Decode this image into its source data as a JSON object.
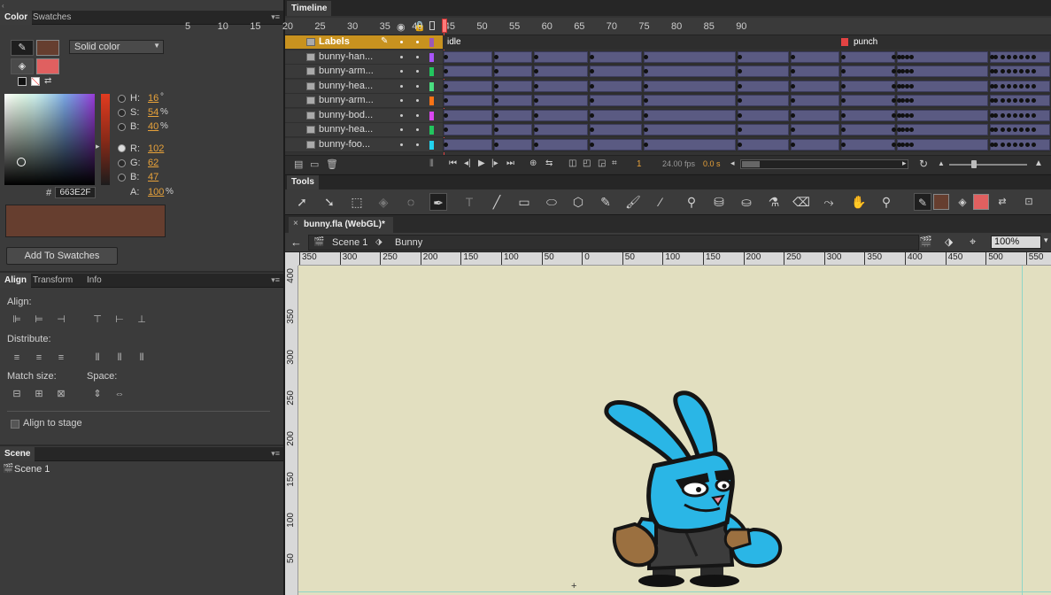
{
  "color_panel": {
    "tabs": [
      "Color",
      "Swatches"
    ],
    "fill_type": "Solid color",
    "hsb": {
      "h_label": "H:",
      "h": "16",
      "h_unit": "°",
      "s_label": "S:",
      "s": "54",
      "s_unit": "%",
      "b_label": "B:",
      "b": "40",
      "b_unit": "%"
    },
    "rgb": {
      "r_label": "R:",
      "r": "102",
      "g_label": "G:",
      "g": "62",
      "b_label": "B:",
      "b": "47"
    },
    "hex_prefix": "#",
    "hex": "663E2F",
    "alpha_label": "A:",
    "alpha": "100",
    "alpha_unit": "%",
    "add_swatch_label": "Add To Swatches",
    "colors": {
      "stroke": "#663e2f",
      "fill": "#e06060"
    }
  },
  "align_panel": {
    "tabs": [
      "Align",
      "Transform",
      "Info"
    ],
    "align_label": "Align:",
    "distribute_label": "Distribute:",
    "match_size_label": "Match size:",
    "space_label": "Space:",
    "align_to_stage": "Align to stage"
  },
  "scene_panel": {
    "tab": "Scene",
    "items": [
      "Scene 1"
    ]
  },
  "timeline": {
    "title": "Timeline",
    "frame_numbers": [
      "5",
      "10",
      "15",
      "20",
      "25",
      "30",
      "35",
      "40",
      "45",
      "50",
      "55",
      "60",
      "65",
      "70",
      "75",
      "80",
      "85",
      "90"
    ],
    "layers": [
      {
        "name": "Labels",
        "color": "#9b59b6"
      },
      {
        "name": "bunny-han...",
        "color": "#a855f7"
      },
      {
        "name": "bunny-arm...",
        "color": "#22c55e"
      },
      {
        "name": "bunny-hea...",
        "color": "#4ade80"
      },
      {
        "name": "bunny-arm...",
        "color": "#f97316"
      },
      {
        "name": "bunny-bod...",
        "color": "#d946ef"
      },
      {
        "name": "bunny-hea...",
        "color": "#22c55e"
      },
      {
        "name": "bunny-foo...",
        "color": "#22d3ee"
      }
    ],
    "labels": [
      "idle",
      "punch"
    ],
    "current_frame": "1",
    "fps": "24.00 fps",
    "time": "0.0 s"
  },
  "tools_panel": {
    "title": "Tools",
    "stroke_color": "#663e2f",
    "fill_color": "#e06060"
  },
  "document": {
    "tab": "bunny.fla (WebGL)*",
    "breadcrumb_scene": "Scene 1",
    "breadcrumb_symbol": "Bunny",
    "zoom": "100%"
  },
  "ruler": {
    "h_labels": [
      "350",
      "300",
      "250",
      "200",
      "150",
      "100",
      "50",
      "0",
      "50",
      "100",
      "150",
      "200",
      "250",
      "300",
      "350",
      "400",
      "450",
      "500",
      "550"
    ],
    "v_labels": [
      "400",
      "350",
      "300",
      "250",
      "200",
      "150",
      "100",
      "50"
    ]
  },
  "stage": {
    "background": "#e2dfc0"
  }
}
